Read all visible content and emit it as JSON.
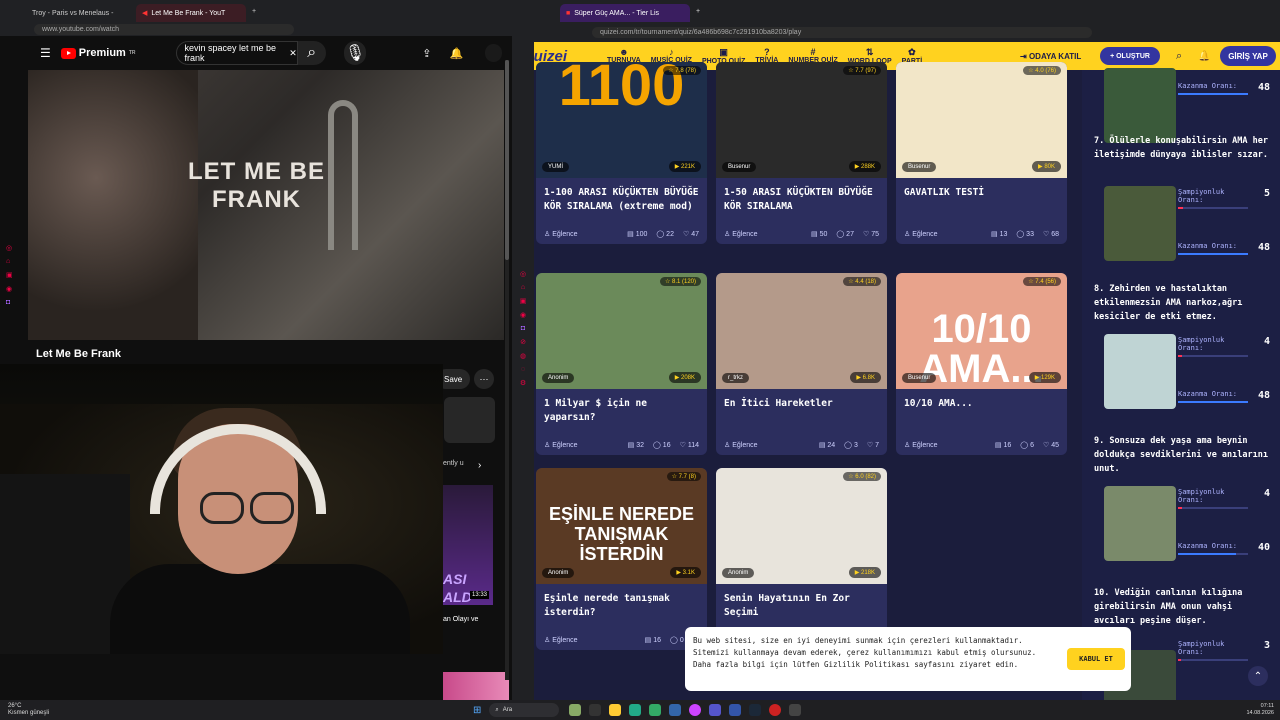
{
  "left_browser": {
    "tabs": [
      "Troy - Paris vs Menelaus -",
      "Let Me Be Frank - YouT"
    ],
    "url": "www.youtube.com/watch",
    "yt_brand": "Premium",
    "yt_region": "TR",
    "search_value": "kevin spacey let me be frank",
    "video_caption": "LET ME BE\nFRANK",
    "video_title": "Let Me Be Frank",
    "save_label": "Save",
    "rec_text1": "ently u",
    "rec_duration": "13:33",
    "rec_title": "an Olayı ve"
  },
  "right_browser": {
    "tab": "Süper Güç AMA... - Tier Lis",
    "url": "quizei.com/tr/tournament/quiz/6a486b698c7c291910ba8203/play",
    "logo": "Quizei",
    "nav": [
      {
        "icon": "☻",
        "label": "TURNUVA"
      },
      {
        "icon": "♪",
        "label": "MUSİC QUİZ"
      },
      {
        "icon": "▣",
        "label": "PHOTO QUİZ"
      },
      {
        "icon": "?",
        "label": "TRİVİA"
      },
      {
        "icon": "#",
        "label": "NUMBER QUİZ"
      },
      {
        "icon": "⇅",
        "label": "WORD LOOP"
      },
      {
        "icon": "✿",
        "label": "PARTİ"
      }
    ],
    "join_room": "ODAYA KATIL",
    "create": "+ OLUŞTUR",
    "login": "GİRİŞ YAP"
  },
  "cards": [
    {
      "title": "1-100 ARASI KÜÇÜKTEN BÜYÜĞE KÖR SIRALAMA (extreme mod)",
      "rating": "☆ 7.8 (78)",
      "author": "YUMİ",
      "plays": "▶ 221K",
      "category": "Eğlence",
      "questions": "100",
      "comments": "22",
      "likes": "47",
      "img": "1100",
      "bg": "#1e2e4a"
    },
    {
      "title": "1-50 ARASI KÜÇÜKTEN BÜYÜĞE KÖR SIRALAMA",
      "rating": "☆ 7.7 (97)",
      "author": "Busenur",
      "plays": "▶ 288K",
      "category": "Eğlence",
      "questions": "50",
      "comments": "27",
      "likes": "75",
      "img": "",
      "bg": "#2a2a2a"
    },
    {
      "title": "GAVATLIK TESTİ",
      "rating": "☆ 4.0 (76)",
      "author": "Busenur",
      "plays": "▶ 80K",
      "category": "Eğlence",
      "questions": "13",
      "comments": "33",
      "likes": "68",
      "img": "",
      "bg": "#f2e6c8"
    },
    {
      "title": "1 Milyar $ için ne yaparsın?",
      "rating": "☆ 8.1 (120)",
      "author": "Anonim",
      "plays": "▶ 208K",
      "category": "Eğlence",
      "questions": "32",
      "comments": "16",
      "likes": "114",
      "img": "",
      "bg": "#6b8a5a"
    },
    {
      "title": "En İtici Hareketler",
      "rating": "☆ 4.4 (18)",
      "author": "r_trkz",
      "plays": "▶ 6.8K",
      "category": "Eğlence",
      "questions": "24",
      "comments": "3",
      "likes": "7",
      "img": "",
      "bg": "#b49a8a"
    },
    {
      "title": "10/10 AMA...",
      "rating": "☆ 7.4 (56)",
      "author": "Busenur",
      "plays": "▶ 129K",
      "category": "Eğlence",
      "questions": "16",
      "comments": "6",
      "likes": "45",
      "img": "10/10\nAMA...",
      "bg": "#e8a38c"
    },
    {
      "title": "Eşinle nerede tanışmak isterdin?",
      "rating": "☆ 7.7 (8)",
      "author": "Anonim",
      "plays": "▶ 3.1K",
      "category": "Eğlence",
      "questions": "16",
      "comments": "0",
      "likes": "",
      "img": "EŞİNLE NEREDE\nTANIŞMAK İSTERDİN",
      "bg": "#5a3a24"
    },
    {
      "title": "Senin Hayatının En Zor Seçimi",
      "rating": "☆ 6.0 (82)",
      "author": "Anonim",
      "plays": "▶ 218K",
      "category": "",
      "questions": "",
      "comments": "",
      "likes": "",
      "img": "",
      "bg": "#e8e4dc"
    }
  ],
  "ranking": [
    {
      "text": "",
      "champ_label": "Kazanma Oranı:",
      "champ": "48"
    },
    {
      "text": "7. Ölülerle konuşabilirsin AMA her iletişimde dünyaya iblisler sızar.",
      "champ_label": "Şampiyonluk Oranı:",
      "champ": "5",
      "win_label": "Kazanma Oranı:",
      "win": "48"
    },
    {
      "text": "8. Zehirden ve hastalıktan etkilenmezsin AMA narkoz,ağrı kesiciler de etki etmez.",
      "champ_label": "Şampiyonluk Oranı:",
      "champ": "4",
      "win_label": "Kazanma Oranı:",
      "win": "48"
    },
    {
      "text": "9. Sonsuza dek yaşa ama beynin doldukça sevdiklerini ve anılarını unut.",
      "champ_label": "Şampiyonluk Oranı:",
      "champ": "4",
      "win_label": "Kazanma Oranı:",
      "win": "40"
    },
    {
      "text": "10. Vediğin canlının kılığına girebilirsin AMA onun vahşi avcıları peşine düşer.",
      "champ_label": "Şampiyonluk Oranı:",
      "champ": "3"
    }
  ],
  "cookie": {
    "text": "Bu web sitesi, size en iyi deneyimi sunmak için çerezleri kullanmaktadır. Sitemizi kullanmaya devam ederek, çerez kullanımımızı kabul etmiş olursunuz. Daha fazla bilgi için lütfen Gizlilik Politikası sayfasını ziyaret edin.",
    "button": "KABUL ET"
  },
  "taskbar": {
    "weather_temp": "26°C",
    "weather_text": "Kısmen güneşli",
    "search": "Ara",
    "time": "07:11",
    "date": "14.08.2026"
  },
  "colors": {
    "accent": "#ffd21f",
    "brand": "#3335a0",
    "bg": "#1b1d3c"
  }
}
